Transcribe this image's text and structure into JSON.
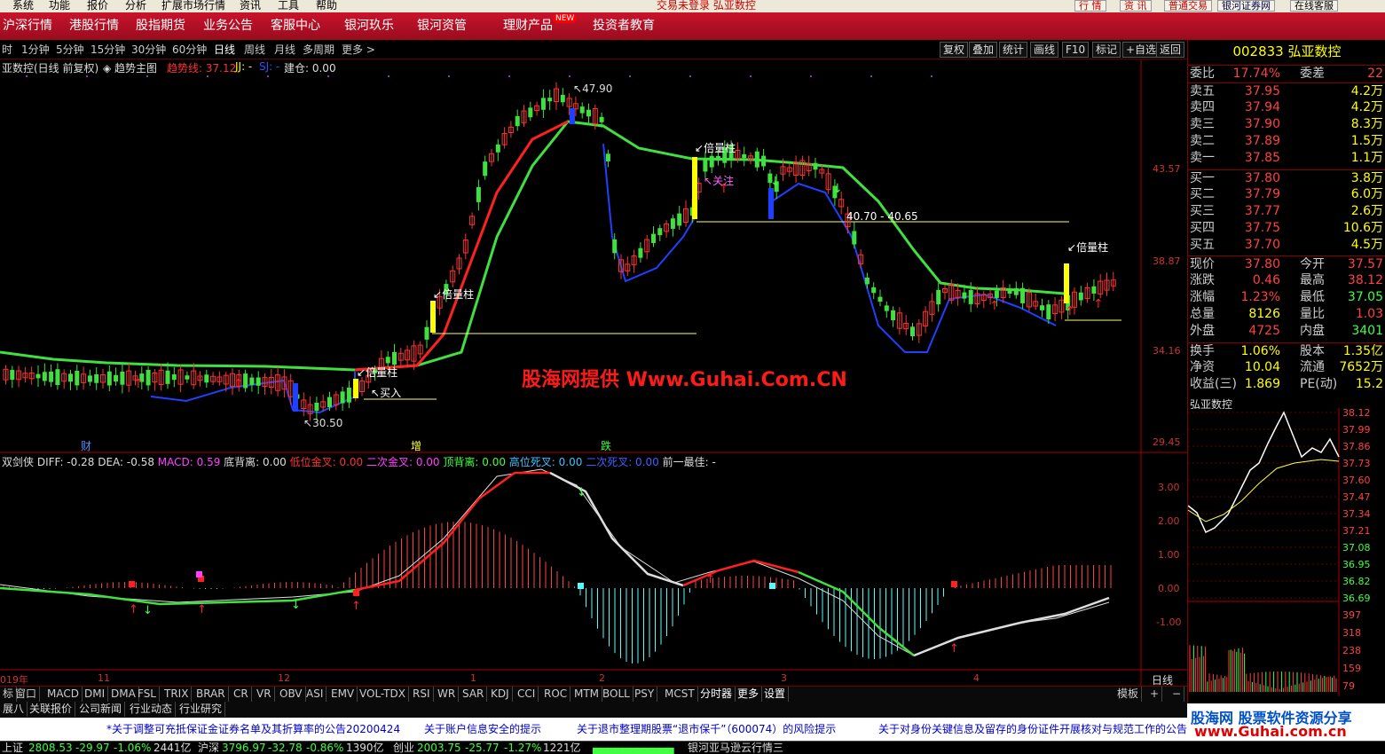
{
  "menubar": {
    "items": [
      "系统",
      "功能",
      "报价",
      "分析",
      "扩展市场行情",
      "资讯",
      "工具",
      "帮助"
    ],
    "title": "交易未登录  弘亚数控",
    "right_buttons": [
      "行 情",
      "资 讯",
      "普通交易",
      "银河证券网",
      "在线客服"
    ]
  },
  "nav": {
    "items": [
      "沪深行情",
      "港股行情",
      "股指期货",
      "业务公告",
      "客服中心",
      "银河玖乐",
      "银河资管",
      "理财产品",
      "投资者教育"
    ],
    "hot": "NEW"
  },
  "toolbar": {
    "periods": [
      "时",
      "1分钟",
      "5分钟",
      "15分钟",
      "30分钟",
      "60分钟",
      "日线",
      "周线",
      "月线",
      "多周期",
      "更多 >"
    ],
    "active": "日线",
    "right": [
      "复权",
      "叠加",
      "统计",
      "画线",
      "F10",
      "标记",
      "+自选",
      "返回"
    ]
  },
  "main": {
    "title": "亚数控(日线 前复权)",
    "trend": "趋势主图",
    "trend_label": "趋势线: 37.12",
    "jj": "JJ: -",
    "sj": "SJ: -",
    "jiancang": "建仓: 0.00",
    "y_ticks": [
      "43.57",
      "38.87",
      "34.16",
      "29.45"
    ],
    "watermark": "股海网提供 Www.Guhai.Com.CN",
    "annotations": {
      "high": "47.90",
      "low": "30.50",
      "range": "40.70 - 40.65",
      "beiliang": "倍量柱",
      "buy": "买入",
      "watch": "关注"
    },
    "markers": [
      "财",
      "增",
      "跌"
    ]
  },
  "macd": {
    "title": "双剑侠",
    "diff": "DIFF: -0.28",
    "dea": "DEA: -0.58",
    "macd": "MACD: 0.59",
    "dibeili": "底背离: 0.00",
    "diwei": "低位金叉: 0.00",
    "erci": "二次金叉: 0.00",
    "dingbeili": "顶背离: 0.00",
    "gaowei": "高位死叉: 0.00",
    "ercisi": "二次死叉: 0.00",
    "qianyi": "前一最佳: -",
    "y_ticks": [
      "3.00",
      "2.00",
      "1.00",
      "0.00",
      "-1.00"
    ]
  },
  "xaxis": {
    "labels": [
      "019年",
      "11",
      "12",
      "1",
      "2",
      "3",
      "4"
    ],
    "period": "日线"
  },
  "indicator_tabs": [
    "标",
    "窗口",
    "MACD",
    "DMI",
    "DMA",
    "FSL",
    "TRIX",
    "BRAR",
    "CR",
    "VR",
    "OBV",
    "ASI",
    "EMV",
    "VOL-TDX",
    "RSI",
    "WR",
    "SAR",
    "KDJ",
    "CCI",
    "ROC",
    "MTM",
    "BOLL",
    "PSY",
    "MCST",
    "分时器",
    "更多",
    "设置"
  ],
  "tab_right": [
    "模板",
    "+",
    "−"
  ],
  "info_tabs": [
    "展八",
    "关联报价",
    "公司新闻",
    "行业动态",
    "行业研究"
  ],
  "news": [
    "*关于调整可充抵保证金证券名单及其折算率的公告20200424",
    "关于账户信息安全的提示",
    "关于退市整理期股票“退市保千”（600074）的风险提示",
    "关于对身份关键信息及留存的身份证件开展核对与规范工作的公告"
  ],
  "quote": {
    "code": "002833",
    "name": "弘亚数控",
    "weibi_k": "委比",
    "weibi": "17.74%",
    "weicha_k": "委差",
    "weicha": "22",
    "asks": [
      {
        "k": "卖五",
        "p": "37.95",
        "v": "4.2万"
      },
      {
        "k": "卖四",
        "p": "37.94",
        "v": "4.2万"
      },
      {
        "k": "卖三",
        "p": "37.90",
        "v": "8.3万"
      },
      {
        "k": "卖二",
        "p": "37.89",
        "v": "1.5万"
      },
      {
        "k": "卖一",
        "p": "37.85",
        "v": "1.1万"
      }
    ],
    "bids": [
      {
        "k": "买一",
        "p": "37.80",
        "v": "3.8万"
      },
      {
        "k": "买二",
        "p": "37.79",
        "v": "6.0万"
      },
      {
        "k": "买三",
        "p": "37.77",
        "v": "2.6万"
      },
      {
        "k": "买四",
        "p": "37.75",
        "v": "10.6万"
      },
      {
        "k": "买五",
        "p": "37.70",
        "v": "4.5万"
      }
    ],
    "stats": [
      [
        "现价",
        "37.80",
        "今开",
        "37.57"
      ],
      [
        "涨跌",
        "0.46",
        "最高",
        "38.12"
      ],
      [
        "涨幅",
        "1.23%",
        "最低",
        "37.05"
      ],
      [
        "总量",
        "8126",
        "量比",
        "1.03"
      ],
      [
        "外盘",
        "4725",
        "内盘",
        "3401"
      ],
      [
        "换手",
        "1.06%",
        "股本",
        "1.35亿"
      ],
      [
        "净资",
        "10.04",
        "流通",
        "7652万"
      ],
      [
        "收益(三)",
        "1.869",
        "PE(动)",
        "15.2"
      ]
    ],
    "mini_title": "弘亚数控",
    "mini_ticks": [
      "38.12",
      "37.99",
      "37.86",
      "37.73",
      "37.60",
      "37.47",
      "37.34",
      "37.21",
      "37.08",
      "36.95",
      "36.82",
      "36.69"
    ],
    "vol_ticks": [
      "397",
      "318",
      "238",
      "159",
      "79"
    ]
  },
  "status": {
    "sh": "上证",
    "sh_v": "2808.53",
    "sh_c": "-29.97",
    "sh_p": "-1.06%",
    "sh_a": "2441亿",
    "sz": "沪深",
    "sz_v": "3796.97",
    "sz_c": "-32.78",
    "sz_p": "-0.86%",
    "sz_a": "1390亿",
    "cy": "创业",
    "cy_v": "2003.75",
    "cy_c": "-25.77",
    "cy_p": "-1.27%",
    "cy_a": "1221亿",
    "msg": "银河亚马逊云行情三"
  },
  "logo": {
    "top": "股海网  股票软件资源分享",
    "url": "www.Guhai.com.cn"
  },
  "colors": {
    "up": "#ff3232",
    "down": "#54fcfc",
    "trend": "#ff2020",
    "green": "#40e040",
    "blue": "#2040ff",
    "yellow": "#ffff00"
  }
}
